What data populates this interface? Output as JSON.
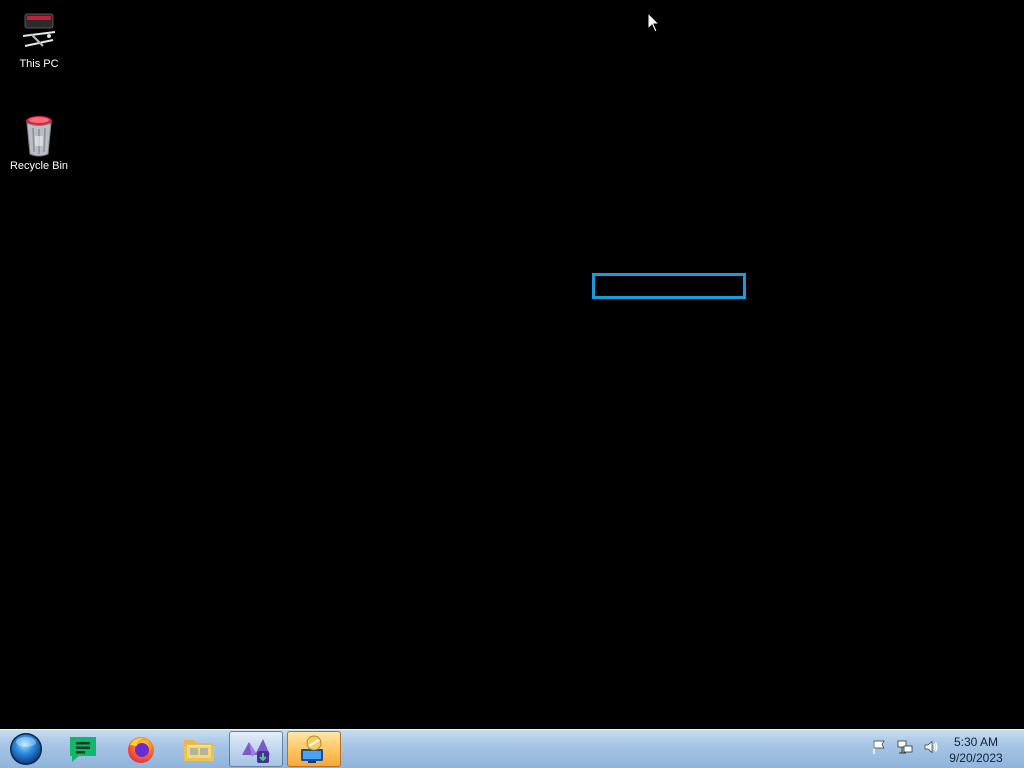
{
  "desktop": {
    "icons": [
      {
        "label": "This PC",
        "icon": "computer-icon"
      },
      {
        "label": "Recycle Bin",
        "icon": "recycle-bin-icon"
      }
    ],
    "background_color": "#000000",
    "selection_rect_color": "#1a9ad8"
  },
  "taskbar": {
    "start_icon": "windows-orb-icon",
    "pinned": [
      {
        "name": "notes-app",
        "icon": "notes-icon",
        "state": "pinned"
      },
      {
        "name": "firefox",
        "icon": "firefox-icon",
        "state": "pinned"
      },
      {
        "name": "file-explorer",
        "icon": "folder-icon",
        "state": "pinned"
      },
      {
        "name": "visual-studio-installer",
        "icon": "visual-studio-installer-icon",
        "state": "open"
      },
      {
        "name": "remote-desktop",
        "icon": "remote-desktop-icon",
        "state": "active"
      }
    ],
    "tray": [
      {
        "icon": "action-center-flag-icon"
      },
      {
        "icon": "network-icon"
      },
      {
        "icon": "volume-icon"
      }
    ],
    "clock": {
      "time": "5:30 AM",
      "date": "9/20/2023"
    }
  }
}
